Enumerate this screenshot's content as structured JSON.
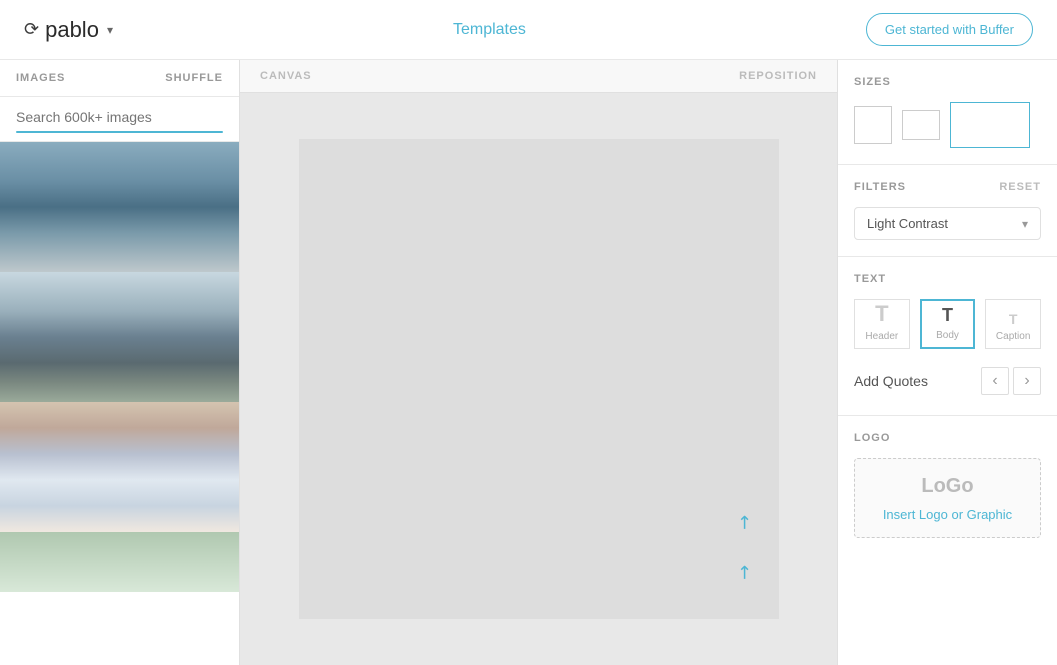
{
  "header": {
    "logo_text": "pablo",
    "nav_templates": "Templates",
    "get_started": "Get started with Buffer"
  },
  "left_panel": {
    "title": "IMAGES",
    "shuffle": "SHUFFLE",
    "search_placeholder": "Search 600k+ images"
  },
  "canvas": {
    "label": "CANVAS",
    "reposition": "REPOSITION"
  },
  "right_panel": {
    "sizes_title": "SIZES",
    "filters_title": "FILTERS",
    "filters_reset": "RESET",
    "filter_selected": "Light Contrast",
    "text_title": "TEXT",
    "text_header": "Header",
    "text_body": "Body",
    "text_caption": "Caption",
    "add_quotes": "Add Quotes",
    "logo_title": "LOGO",
    "logo_insert": "Insert Logo or Graphic"
  }
}
